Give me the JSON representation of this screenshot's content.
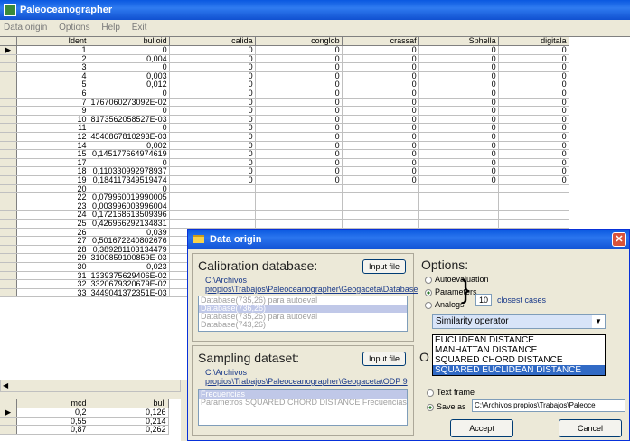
{
  "window": {
    "title": "Paleoceanographer"
  },
  "menu": [
    "Data origin",
    "Options",
    "Help",
    "Exit"
  ],
  "table": {
    "columns": [
      "Ident",
      "bulloid",
      "calida",
      "conglob",
      "crassaf",
      "Sphella",
      "digitala"
    ],
    "rows": [
      [
        "1",
        "0",
        "0",
        "0",
        "0",
        "0",
        "0"
      ],
      [
        "2",
        "0,004",
        "0",
        "0",
        "0",
        "0",
        "0"
      ],
      [
        "3",
        "0",
        "0",
        "0",
        "0",
        "0",
        "0"
      ],
      [
        "4",
        "0,003",
        "0",
        "0",
        "0",
        "0",
        "0"
      ],
      [
        "5",
        "0,012",
        "0",
        "0",
        "0",
        "0",
        "0"
      ],
      [
        "6",
        "0",
        "0",
        "0",
        "0",
        "0",
        "0"
      ],
      [
        "7",
        "1767060273092E-02",
        "0",
        "0",
        "0",
        "0",
        "0"
      ],
      [
        "9",
        "0",
        "0",
        "0",
        "0",
        "0",
        "0"
      ],
      [
        "10",
        "8173562058527E-03",
        "0",
        "0",
        "0",
        "0",
        "0"
      ],
      [
        "11",
        "0",
        "0",
        "0",
        "0",
        "0",
        "0"
      ],
      [
        "12",
        "4540867810293E-03",
        "0",
        "0",
        "0",
        "0",
        "0"
      ],
      [
        "14",
        "0,002",
        "0",
        "0",
        "0",
        "0",
        "0"
      ],
      [
        "15",
        "0,145177664974619",
        "0",
        "0",
        "0",
        "0",
        "0"
      ],
      [
        "17",
        "0",
        "0",
        "0",
        "0",
        "0",
        "0"
      ],
      [
        "18",
        "0,110330992978937",
        "0",
        "0",
        "0",
        "0",
        "0"
      ],
      [
        "19",
        "0,184117349519474",
        "0",
        "0",
        "0",
        "0",
        "0"
      ],
      [
        "20",
        "0",
        "",
        "",
        "",
        "",
        ""
      ],
      [
        "22",
        "0,079960019990005",
        "",
        "",
        "",
        "",
        ""
      ],
      [
        "23",
        "0,003996003996004",
        "",
        "",
        "",
        "",
        ""
      ],
      [
        "24",
        "0,172168613509396",
        "",
        "",
        "",
        "",
        ""
      ],
      [
        "25",
        "0,426966292134831",
        "",
        "",
        "",
        "",
        ""
      ],
      [
        "26",
        "0,039",
        "",
        "",
        "",
        "",
        ""
      ],
      [
        "27",
        "0,501672240802676",
        "",
        "",
        "",
        "",
        ""
      ],
      [
        "28",
        "0,389281103134479",
        "",
        "",
        "",
        "",
        ""
      ],
      [
        "29",
        "3100859100859E-03",
        "",
        "",
        "",
        "",
        ""
      ],
      [
        "30",
        "0,023",
        "",
        "",
        "",
        "",
        ""
      ],
      [
        "31",
        "1339375629406E-02",
        "",
        "",
        "",
        "",
        ""
      ],
      [
        "32",
        "3320679320679E-02",
        "",
        "",
        "",
        "",
        ""
      ],
      [
        "33",
        "3449041372351E-03",
        "",
        "",
        "",
        "",
        ""
      ]
    ]
  },
  "table2": {
    "columns": [
      "mcd",
      "bull"
    ],
    "rows": [
      [
        "0,2",
        "0,126"
      ],
      [
        "0,55",
        "0,214"
      ],
      [
        "0,87",
        "0,262"
      ]
    ]
  },
  "dialog": {
    "title": "Data origin",
    "calibration": {
      "heading": "Calibration database:",
      "input_button": "Input file",
      "path_line1": "C:\\Archivos",
      "path_line2": "propios\\Trabajos\\Paleoceanographer\\Geogaceta\\Database",
      "items": [
        "Database(735,26) para autoeval",
        "Database(736,26)",
        "Database(735,26) para autoeval",
        "Database(743,26)"
      ]
    },
    "sampling": {
      "heading": "Sampling dataset:",
      "input_button": "Input file",
      "path_line1": "C:\\Archivos",
      "path_line2": "propios\\Trabajos\\Paleoceanographer\\Geogaceta\\ODP 9",
      "items": [
        "Frecuencias",
        "Parametros SQUARED CHORD DISTANCE Frecuencias"
      ]
    },
    "options": {
      "heading": "Options:",
      "radio_autoevaluation": "Autoevaluation",
      "radio_parameters": "Parameters",
      "radio_analogs": "Analogs",
      "closest_value": "10",
      "closest_label": "closest cases",
      "combo_value": "Similarity operator",
      "dropdown": [
        "EUCLIDEAN DISTANCE",
        "MANHATTAN DISTANCE",
        "SQUARED CHORD DISTANCE",
        "SQUARED EUCLIDEAN DISTANCE"
      ]
    },
    "output": {
      "heading_letter": "O",
      "text_frame": "Text frame",
      "save_as": "Save as",
      "save_path": "C:\\Archivos propios\\Trabajos\\Paleoce"
    },
    "accept_button": "Accept",
    "cancel_button": "Cancel"
  }
}
